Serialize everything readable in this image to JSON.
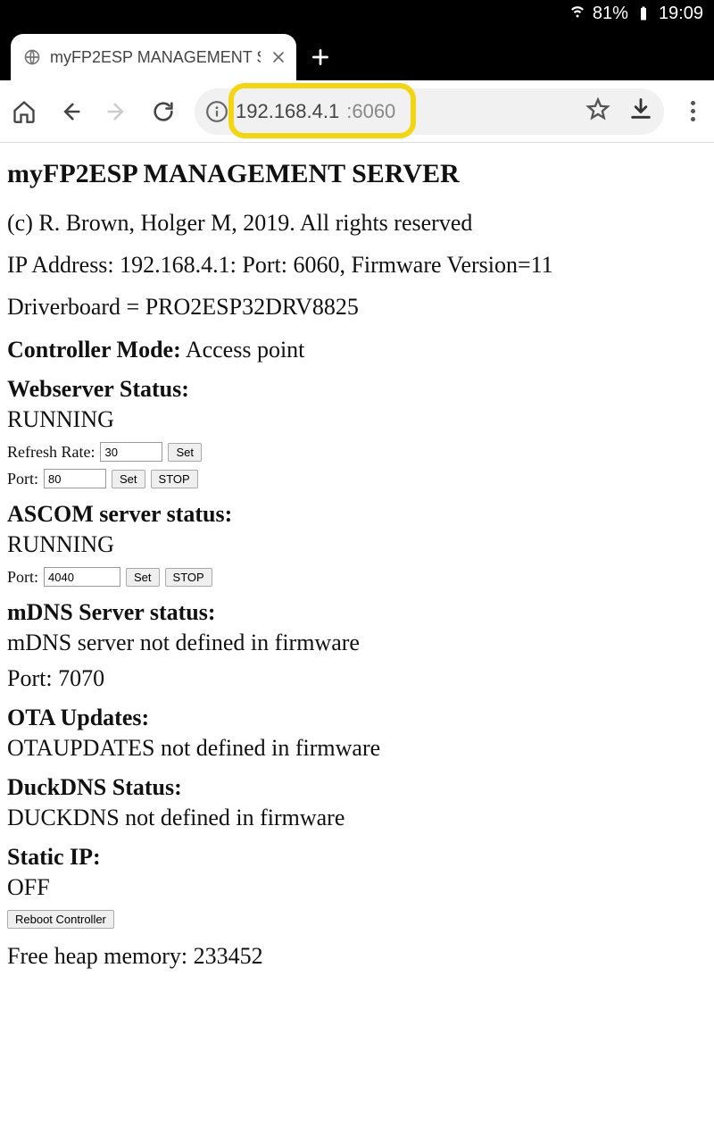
{
  "status": {
    "wifi": true,
    "battery_pct": "81%",
    "time": "19:09"
  },
  "browser": {
    "tab_title": "myFP2ESP MANAGEMENT S",
    "address_host": "192.168.4.1",
    "address_port": ":6060"
  },
  "page": {
    "title": "myFP2ESP MANAGEMENT SERVER",
    "copyright": "(c) R. Brown, Holger M, 2019. All rights reserved",
    "netline": "IP Address: 192.168.4.1: Port: 6060, Firmware Version=11",
    "driverboard": "Driverboard = PRO2ESP32DRV8825",
    "controller_mode_label": "Controller Mode:",
    "controller_mode_value": "Access point",
    "webserver": {
      "label": "Webserver Status:",
      "status": "RUNNING",
      "refresh_label": "Refresh Rate:",
      "refresh_value": "30",
      "refresh_set": "Set",
      "port_label": "Port:",
      "port_value": "80",
      "port_set": "Set",
      "port_stop": "STOP"
    },
    "ascom": {
      "label": "ASCOM server status:",
      "status": "RUNNING",
      "port_label": "Port:",
      "port_value": "4040",
      "port_set": "Set",
      "port_stop": "STOP"
    },
    "mdns": {
      "label": "mDNS Server status:",
      "status": "mDNS server not defined in firmware",
      "port": "Port: 7070"
    },
    "ota": {
      "label": "OTA Updates",
      "status": "OTAUPDATES not defined in firmware"
    },
    "duckdns": {
      "label": "DuckDNS Status:",
      "status": "DUCKDNS not defined in firmware"
    },
    "staticip": {
      "label": "Static IP:",
      "status": "OFF"
    },
    "reboot_label": "Reboot Controller",
    "heap": "Free heap memory: 233452"
  }
}
